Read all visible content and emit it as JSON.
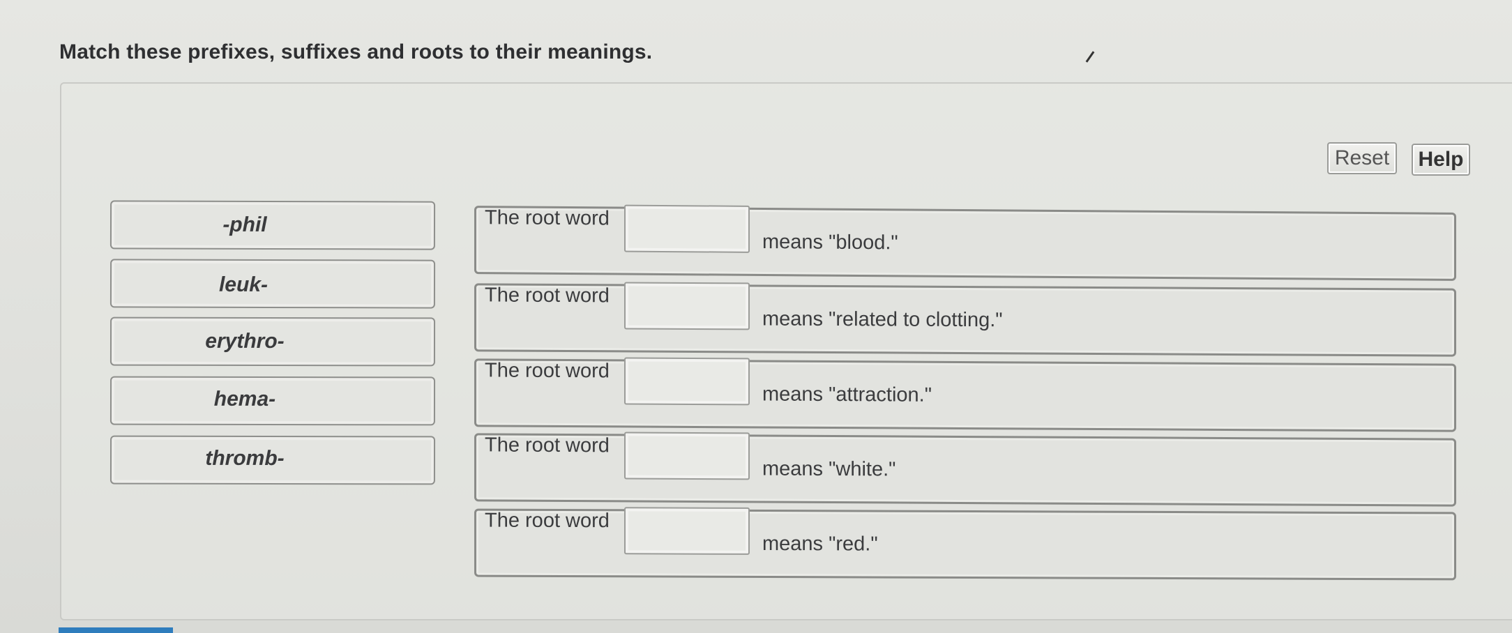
{
  "question": {
    "title": "Match these prefixes, suffixes and roots to their meanings."
  },
  "toolbar": {
    "reset_label": "Reset",
    "help_label": "Help"
  },
  "terms": [
    {
      "label": "-phil"
    },
    {
      "label": "leuk-"
    },
    {
      "label": "erythro-"
    },
    {
      "label": "hema-"
    },
    {
      "label": "thromb-"
    }
  ],
  "sentences": [
    {
      "prefix": "The root word",
      "suffix": "means \"blood.\"",
      "answer": ""
    },
    {
      "prefix": "The root word",
      "suffix": "means \"related to clotting.\"",
      "answer": ""
    },
    {
      "prefix": "The root word",
      "suffix": "means \"attraction.\"",
      "answer": ""
    },
    {
      "prefix": "The root word",
      "suffix": "means \"white.\"",
      "answer": ""
    },
    {
      "prefix": "The root word",
      "suffix": "means \"red.\"",
      "answer": ""
    }
  ],
  "colors": {
    "accent": "#2f7dbd",
    "text": "#3b3c3e",
    "border": "#8a8b88"
  }
}
